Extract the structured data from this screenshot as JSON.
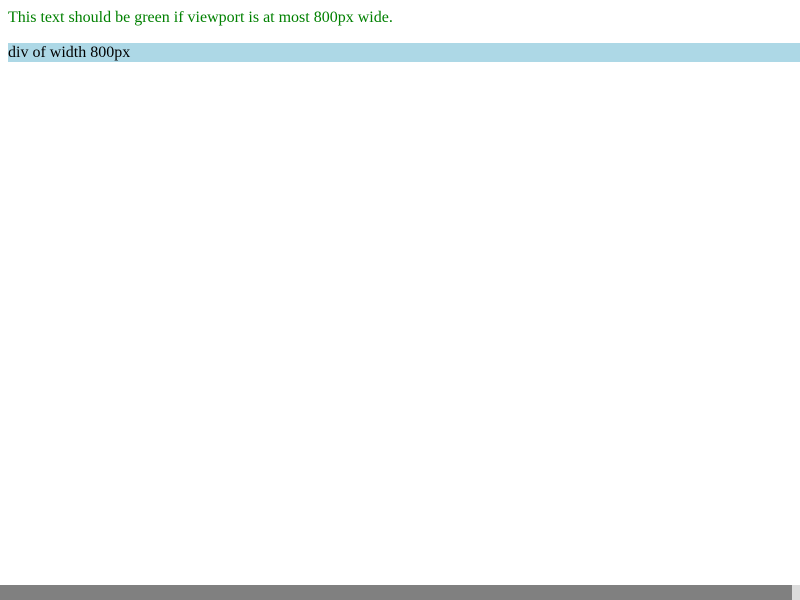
{
  "page": {
    "message": "This text should be green if viewport is at most 800px wide.",
    "div_label": "div of width 800px"
  },
  "colors": {
    "message_text": "#008000",
    "div_background": "#add8e6",
    "scrollbar_thumb": "#808080",
    "scrollbar_track": "#dcdcdc"
  },
  "scrollbar": {
    "visible_fraction": 0.99
  }
}
